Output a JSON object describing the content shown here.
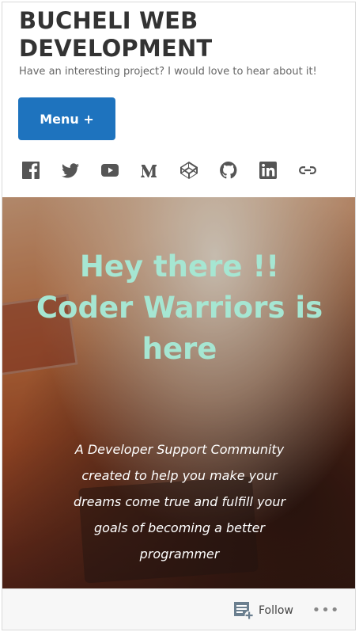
{
  "site": {
    "title": "BUCHELI WEB DEVELOPMENT",
    "tagline": "Have an interesting project? I would love to hear about it!"
  },
  "menu": {
    "label": "Menu +"
  },
  "social": [
    {
      "icon": "facebook-icon"
    },
    {
      "icon": "twitter-icon"
    },
    {
      "icon": "youtube-icon"
    },
    {
      "icon": "medium-icon"
    },
    {
      "icon": "codepen-icon"
    },
    {
      "icon": "github-icon"
    },
    {
      "icon": "linkedin-icon"
    },
    {
      "icon": "link-icon"
    }
  ],
  "hero": {
    "heading": "Hey there !! Coder Warriors is here",
    "text": "A Developer Support Community created to help you make your dreams come true and fulfill your goals of becoming a better programmer"
  },
  "footer": {
    "follow_label": "Follow",
    "more_label": "•••"
  },
  "colors": {
    "accent": "#1e73be",
    "hero_heading": "#a6e6d2"
  }
}
